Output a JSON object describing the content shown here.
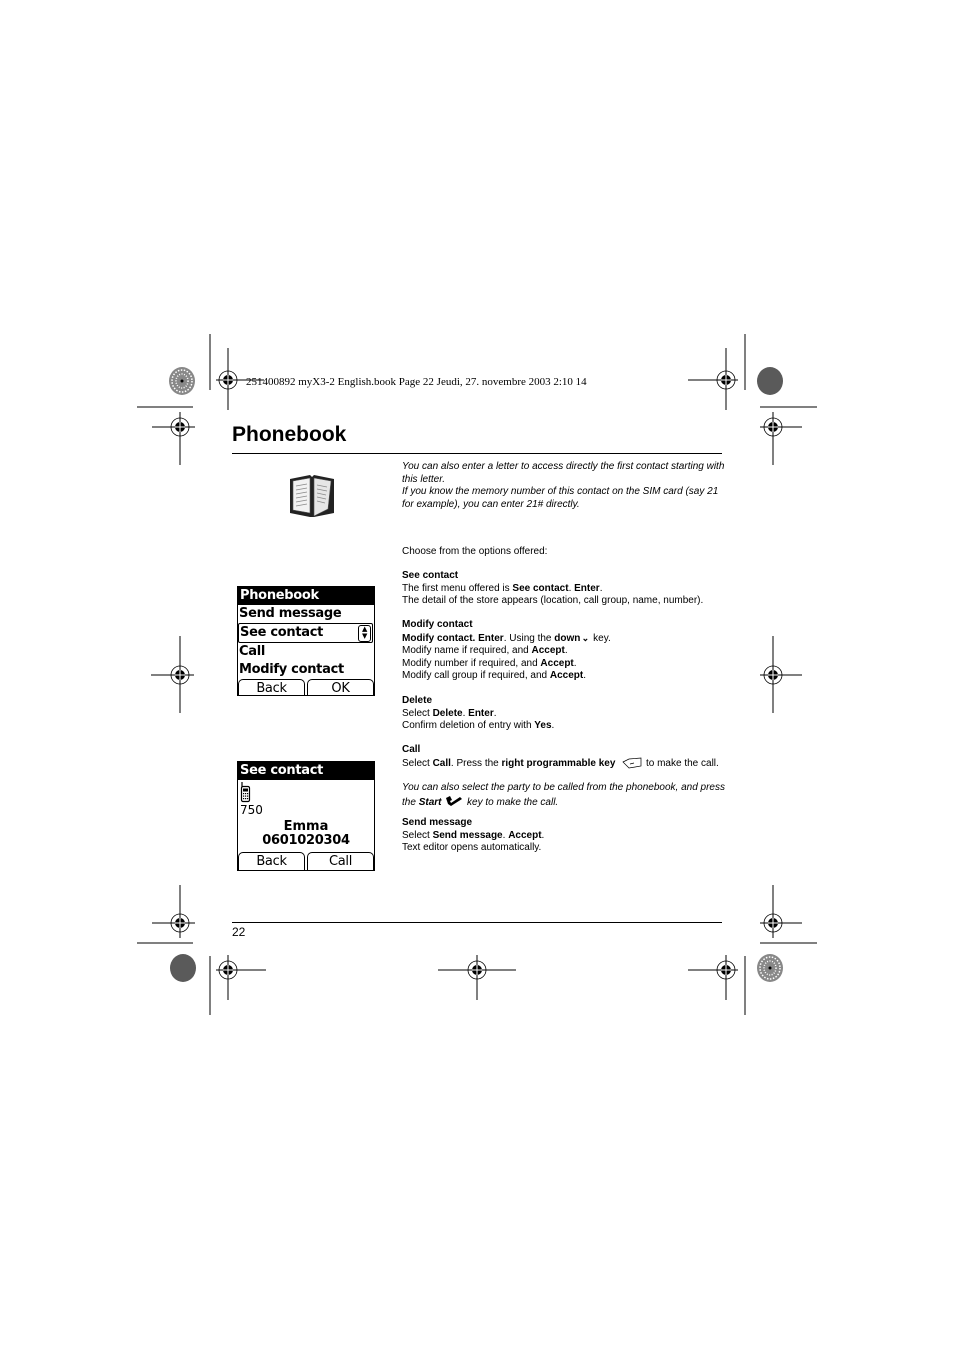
{
  "print_header": "251400892 myX3-2 English.book  Page 22  Jeudi, 27. novembre 2003  2:10 14",
  "page_title": "Phonebook",
  "page_number": "22",
  "intro_note": {
    "line1": "You can also enter a letter to access directly the first contact starting with",
    "line2": "this letter.",
    "line3": "If you know the memory number of this contact on the SIM card (say 21",
    "line4": "for example), you can enter 21# directly."
  },
  "choose_text": "Choose from the options offered:",
  "sections": {
    "see_contact": {
      "heading": "See contact",
      "l1_a": "The first menu offered is ",
      "l1_b": "See contact",
      "l1_c": ". ",
      "l1_d": "Enter",
      "l1_e": ".",
      "l2": "The detail of the store appears (location, call group, name, number)."
    },
    "modify_contact": {
      "heading": "Modify contact",
      "l1_a": "Modify contact. Enter",
      "l1_b": ".  Using the ",
      "l1_c": "down",
      "l1_d": " key.",
      "l2_a": "Modify name if required, and ",
      "l2_b": "Accept",
      "l3_a": "Modify number if required, and ",
      "l3_b": "Accept",
      "l4_a": "Modify call group if required, and ",
      "l4_b": "Accept",
      "dot": "."
    },
    "delete": {
      "heading": "Delete",
      "l1_a": "Select ",
      "l1_b": "Delete",
      "l1_c": ". ",
      "l1_d": "Enter",
      "l1_e": ".",
      "l2_a": "Confirm deletion of entry with ",
      "l2_b": "Yes",
      "l2_c": "."
    },
    "call": {
      "heading": "Call",
      "l1_a": "Select ",
      "l1_b": "Call",
      "l1_c": ". Press the ",
      "l1_d": "right programmable key",
      "l1_e": " to make the call.",
      "note_l1": "You can also select the party to be called from the phonebook, and press",
      "note_l2_a": "the ",
      "note_l2_b": "Start",
      "note_l2_c": " key to make the call."
    },
    "send_message": {
      "heading": "Send message",
      "l1_a": "Select ",
      "l1_b": "Send message",
      "l1_c": ". ",
      "l1_d": "Accept",
      "l1_e": ".",
      "l2": "Text editor opens automatically."
    }
  },
  "screen_menu": {
    "title": "Phonebook",
    "items": [
      "Send message",
      "See contact",
      "Call",
      "Modify contact"
    ],
    "selected_index": 1,
    "softkeys": [
      "Back",
      "OK"
    ]
  },
  "screen_contact": {
    "title": "See contact",
    "location": "750",
    "name": "Emma",
    "number": "0601020304",
    "softkeys": [
      "Back",
      "Call"
    ]
  }
}
